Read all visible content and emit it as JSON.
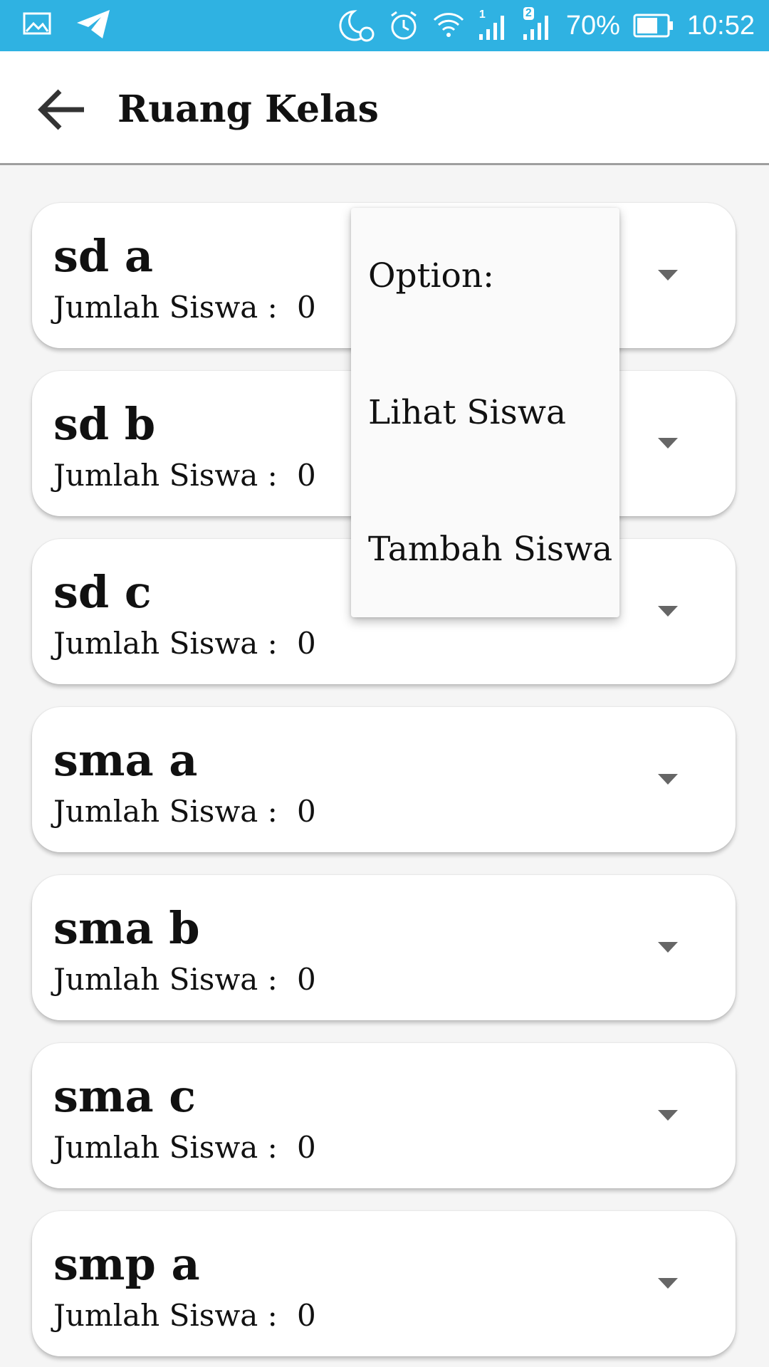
{
  "status_bar": {
    "battery": "70%",
    "time": "10:52",
    "sim1_badge": "1",
    "sim2_badge": "2",
    "icons": [
      "gallery-icon",
      "telegram-icon",
      "do-not-disturb-icon",
      "alarm-icon",
      "wifi-icon",
      "signal-icon",
      "battery-icon"
    ]
  },
  "app_bar": {
    "title": "Ruang Kelas",
    "back_icon": "arrow-back-icon"
  },
  "count_label": "Jumlah Siswa :",
  "classes": [
    {
      "name": "sd a",
      "count": "0"
    },
    {
      "name": "sd b",
      "count": "0"
    },
    {
      "name": "sd c",
      "count": "0"
    },
    {
      "name": "sma a",
      "count": "0"
    },
    {
      "name": "sma b",
      "count": "0"
    },
    {
      "name": "sma c",
      "count": "0"
    },
    {
      "name": "smp a",
      "count": "0"
    }
  ],
  "popup_menu": {
    "header": "Option:",
    "items": [
      "Lihat Siswa",
      "Tambah Siswa"
    ]
  },
  "colors": {
    "status_bar": "#2fb2e2",
    "background": "#f5f5f5",
    "card": "#ffffff",
    "dropdown_arrow": "#666666"
  }
}
